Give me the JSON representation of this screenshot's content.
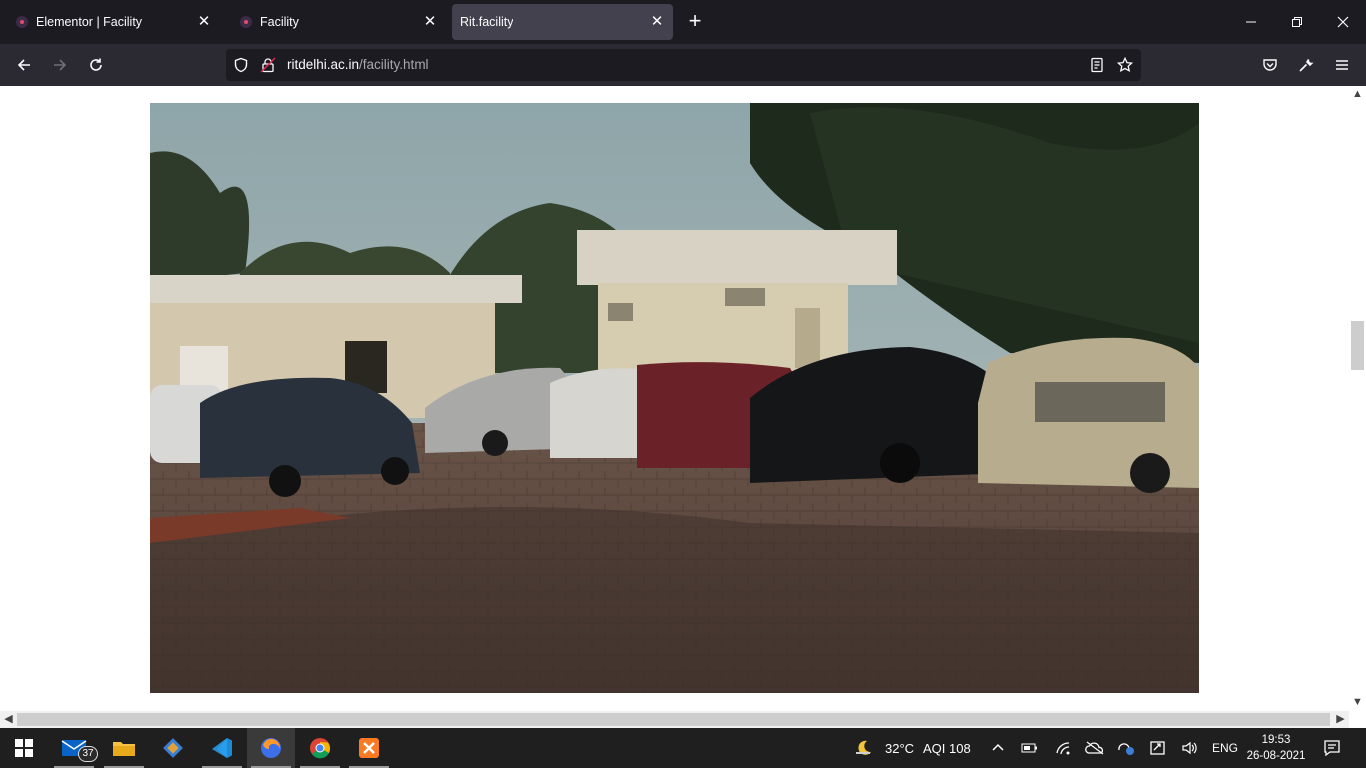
{
  "browser": {
    "tabs": [
      {
        "label": "Elementor | Facility",
        "active": false
      },
      {
        "label": "Facility",
        "active": false
      },
      {
        "label": "Rit.facility",
        "active": true
      }
    ],
    "url": {
      "host": "ritdelhi.ac.in",
      "path": "/facility.html"
    }
  },
  "page": {
    "image_alt": "campus parking area"
  },
  "taskbar": {
    "mail_badge": "37",
    "weather": {
      "temperature": "32°C",
      "aqi": "AQI 108"
    },
    "language": "ENG",
    "clock": {
      "time": "19:53",
      "date": "26-08-2021"
    }
  },
  "colors": {
    "tab_active_bg": "#42414d",
    "toolbar_bg": "#2b2a33",
    "taskbar_bg": "#1f1f1f"
  }
}
